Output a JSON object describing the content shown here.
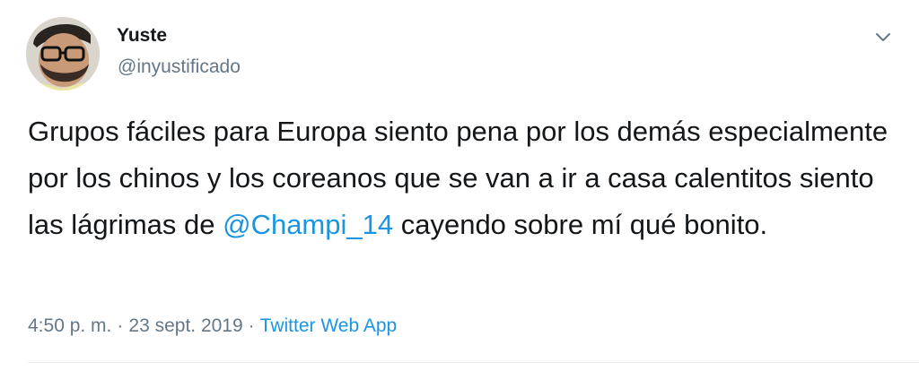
{
  "user": {
    "display_name": "Yuste",
    "handle": "@inyustificado"
  },
  "tweet": {
    "text_before": "Grupos fáciles para Europa siento pena por los demás especialmente por los chinos y los coreanos que se van a ir a casa calentitos siento las lágrimas de ",
    "mention": "@Champi_14",
    "text_after": " cayendo sobre mí qué bonito."
  },
  "meta": {
    "time": "4:50 p. m.",
    "separator": "·",
    "date": "23 sept. 2019",
    "source": "Twitter Web App"
  },
  "icons": {
    "menu": "chevron-down-icon"
  },
  "colors": {
    "text": "#14171a",
    "secondary": "#657786",
    "link": "#1b95e0"
  }
}
